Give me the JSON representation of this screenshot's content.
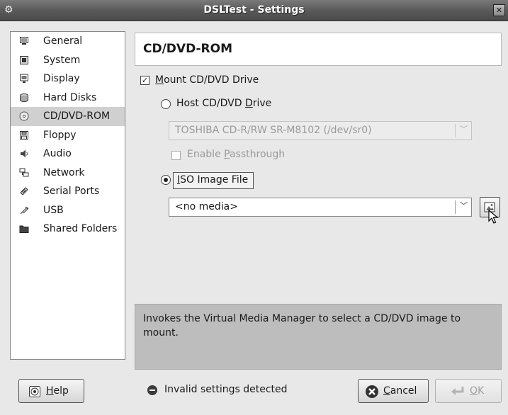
{
  "window": {
    "title": "DSLTest - Settings",
    "close_glyph": "✕"
  },
  "sidebar": {
    "items": [
      {
        "label": "General",
        "icon": "monitor-icon"
      },
      {
        "label": "System",
        "icon": "chip-icon"
      },
      {
        "label": "Display",
        "icon": "display-icon"
      },
      {
        "label": "Hard Disks",
        "icon": "hard-disk-icon"
      },
      {
        "label": "CD/DVD-ROM",
        "icon": "cd-icon"
      },
      {
        "label": "Floppy",
        "icon": "floppy-icon"
      },
      {
        "label": "Audio",
        "icon": "speaker-icon"
      },
      {
        "label": "Network",
        "icon": "network-icon"
      },
      {
        "label": "Serial Ports",
        "icon": "serial-port-icon"
      },
      {
        "label": "USB",
        "icon": "usb-icon"
      },
      {
        "label": "Shared Folders",
        "icon": "folder-icon"
      }
    ],
    "selected_index": 4
  },
  "content": {
    "header": "CD/DVD-ROM",
    "mount_checkbox": {
      "label_first": "M",
      "label_rest": "ount CD/DVD Drive",
      "checked": true
    },
    "host_drive_radio": {
      "label_pre": "Host CD/DVD ",
      "label_mn": "D",
      "label_post": "rive",
      "selected": false
    },
    "host_drive_combo": {
      "value": "TOSHIBA CD-R/RW SR-M8102 (/dev/sr0)",
      "enabled": false
    },
    "passthrough_checkbox": {
      "label_pre": "Enable ",
      "label_mn": "P",
      "label_post": "assthrough",
      "checked": false,
      "enabled": false
    },
    "iso_radio": {
      "label_mn": "I",
      "label_post": "SO Image File",
      "selected": true
    },
    "iso_combo": {
      "value": "<no media>"
    },
    "description": "Invokes the Virtual Media Manager to select a CD/DVD image to mount."
  },
  "footer": {
    "help_label_mn": "H",
    "help_label_post": "elp",
    "status_text": "Invalid settings detected",
    "cancel_label_mn": "C",
    "cancel_label_post": "ancel",
    "ok_label_mn": "O",
    "ok_label_post": "K"
  },
  "colors": {
    "titlebar": "#5a5a5a",
    "selected_item": "#d0d0d0",
    "description_bg": "#bdbdbd",
    "disabled_text": "#9a9a9a"
  }
}
